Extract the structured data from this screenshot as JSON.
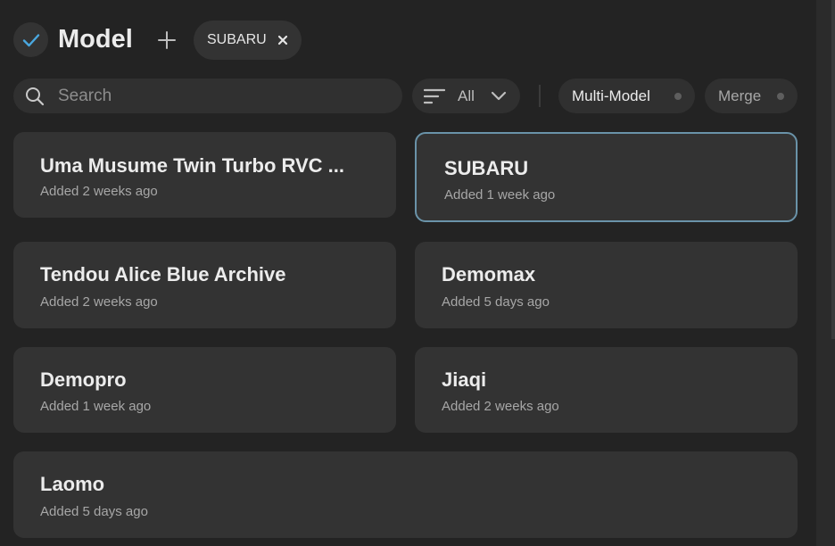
{
  "header": {
    "title": "Model",
    "chip_label": "SUBARU"
  },
  "toolbar": {
    "search_placeholder": "Search",
    "filter_label": "All",
    "multi_model_label": "Multi-Model",
    "merge_label": "Merge"
  },
  "models": [
    {
      "name": "Uma Musume Twin Turbo RVC ...",
      "added": "Added 2 weeks ago"
    },
    {
      "name": "SUBARU",
      "added": "Added 1 week ago",
      "selected": true
    },
    {
      "name": "Tendou Alice Blue Archive",
      "added": "Added 2 weeks ago"
    },
    {
      "name": "Demomax",
      "added": "Added 5 days ago"
    },
    {
      "name": "Demopro",
      "added": "Added 1 week ago"
    },
    {
      "name": "Jiaqi",
      "added": "Added 2 weeks ago"
    },
    {
      "name": "Laomo",
      "added": "Added 5 days ago"
    }
  ],
  "colors": {
    "background": "#232323",
    "card": "#333333",
    "accent_check": "#4aa8e0",
    "selected_border": "#6a93a9"
  }
}
